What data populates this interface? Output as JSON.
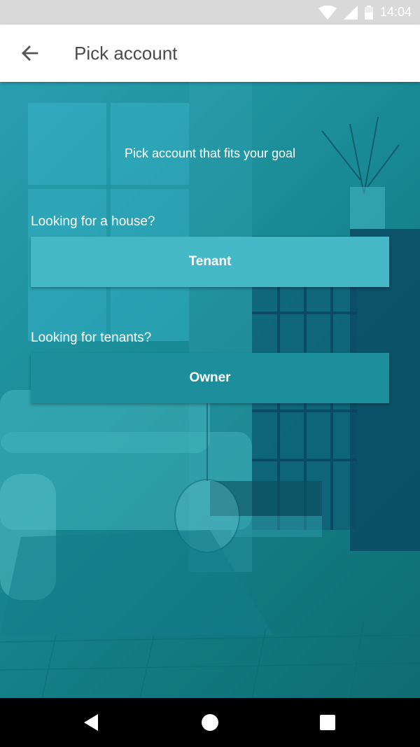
{
  "status_bar": {
    "time": "14:04",
    "icons": [
      "wifi-icon",
      "signal-icon",
      "battery-icon"
    ]
  },
  "app_bar": {
    "title": "Pick account",
    "back_icon": "arrow-left-icon"
  },
  "content": {
    "goal_text": "Pick account that fits your goal",
    "tenant_question": "Looking for a house?",
    "tenant_button": "Tenant",
    "owner_question": "Looking for tenants?",
    "owner_button": "Owner"
  },
  "nav_bar": {
    "icons": [
      "back-triangle-icon",
      "home-circle-icon",
      "recents-square-icon"
    ]
  },
  "colors": {
    "tenant_button": "#45b8c7",
    "owner_button": "#1d8e9c",
    "overlay": "#1c8e9a"
  }
}
